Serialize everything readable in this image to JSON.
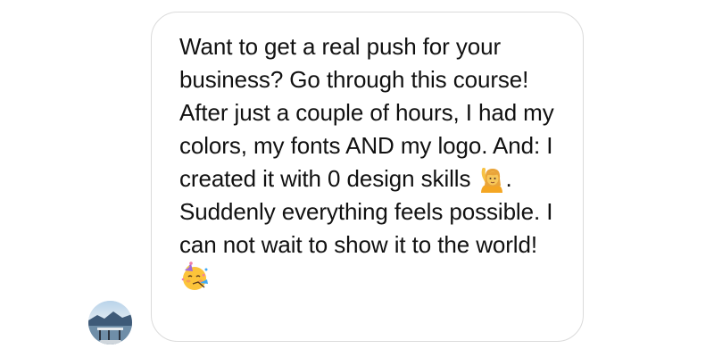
{
  "message": {
    "part1": "Want to get a real push for your business? Go through this course! After just a couple of hours, I had my colors, my fonts AND my logo. And: I created it with 0 design skills",
    "emoji1": "person-raising-hand-emoji",
    "part2": ". Suddenly everything feels possible. I can not wait to show it to the world!",
    "emoji2": "partying-face-emoji"
  },
  "colors": {
    "bubble_border": "#dbdbdb",
    "text": "#111111",
    "background": "#ffffff"
  },
  "avatar": {
    "icon": "avatar-photo"
  }
}
